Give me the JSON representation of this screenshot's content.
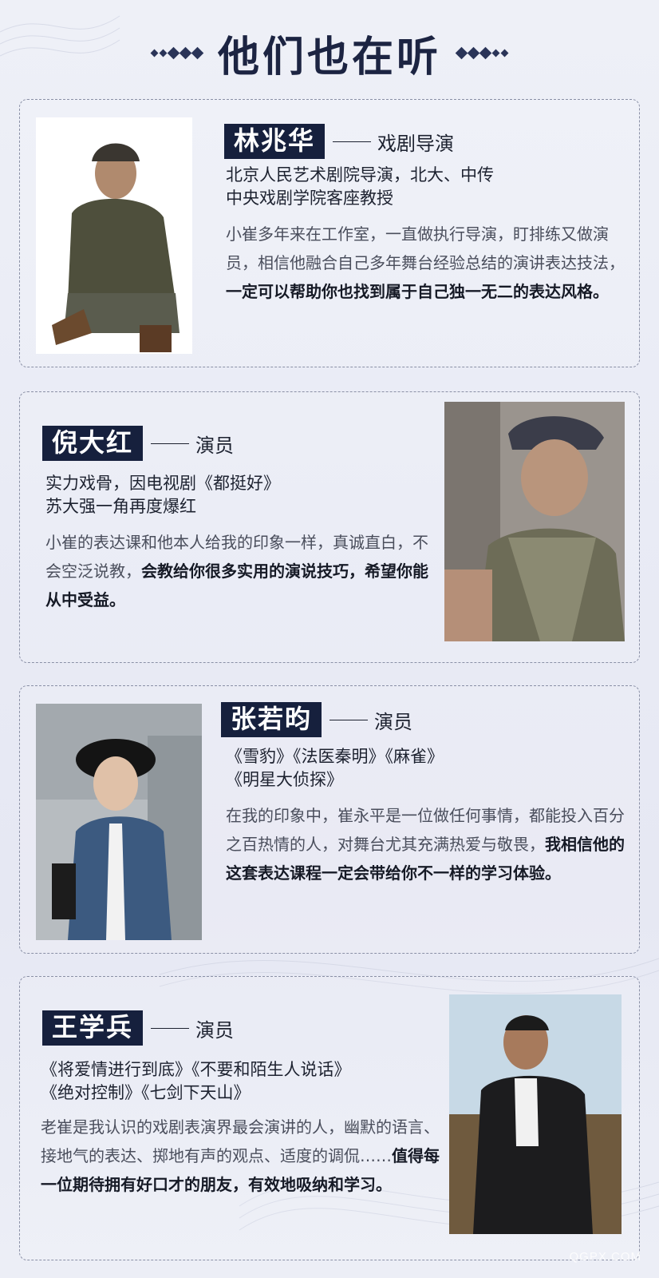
{
  "header": {
    "title": "他们也在听"
  },
  "people": [
    {
      "name": "林兆华",
      "role": "戏剧导演",
      "cred_lines": [
        "北京人民艺术剧院导演，北大、中传",
        "中央戏剧学院客座教授"
      ],
      "desc_normal": "小崔多年来在工作室，一直做执行导演，盯排练又做演员，相信他融合自己多年舞台经验总结的演讲表达技法，",
      "desc_bold": "一定可以帮助你也找到属于自己独一无二的表达风格。"
    },
    {
      "name": "倪大红",
      "role": "演员",
      "cred_lines": [
        "实力戏骨，因电视剧《都挺好》",
        "苏大强一角再度爆红"
      ],
      "desc_normal": "小崔的表达课和他本人给我的印象一样，真诚直白，不会空泛说教，",
      "desc_bold": "会教给你很多实用的演说技巧，希望你能从中受益。"
    },
    {
      "name": "张若昀",
      "role": "演员",
      "cred_lines": [
        "《雪豹》《法医秦明》《麻雀》",
        "《明星大侦探》"
      ],
      "desc_normal": "在我的印象中，崔永平是一位做任何事情，都能投入百分之百热情的人，对舞台尤其充满热爱与敬畏，",
      "desc_bold": "我相信他的这套表达课程一定会带给你不一样的学习体验。"
    },
    {
      "name": "王学兵",
      "role": "演员",
      "cred_lines": [
        "《将爱情进行到底》《不要和陌生人说话》",
        "《绝对控制》《七剑下天山》"
      ],
      "desc_normal": "老崔是我认识的戏剧表演界最会演讲的人，幽默的语言、接地气的表达、掷地有声的观点、适度的调侃……",
      "desc_bold": "值得每一位期待拥有好口才的朋友，有效地吸纳和学习。"
    }
  ],
  "watermark": "QGPX.COM",
  "colors": {
    "name_bg": "#16203d",
    "title": "#1c2442",
    "border": "#8a90a6"
  }
}
